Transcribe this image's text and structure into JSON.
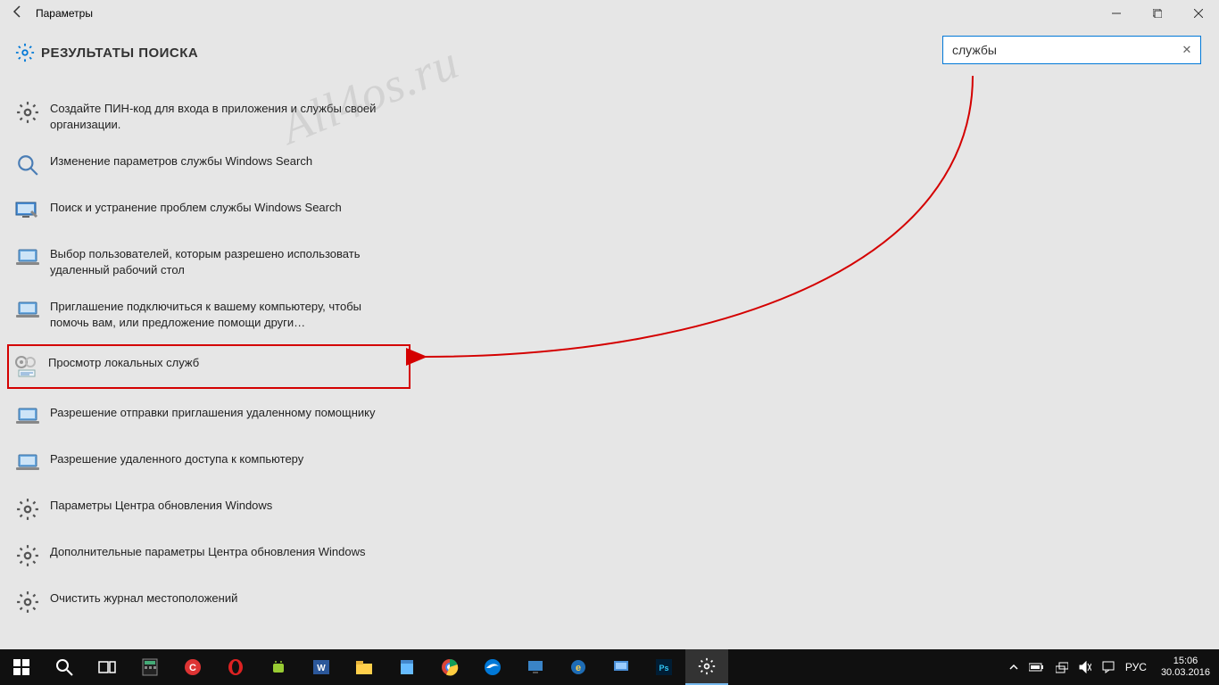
{
  "window": {
    "title": "Параметры",
    "page_heading": "РЕЗУЛЬТАТЫ ПОИСКА"
  },
  "search": {
    "value": "службы",
    "clear_symbol": "✕"
  },
  "results": [
    {
      "icon": "gear",
      "text": "Создайте ПИН-код для входа в приложения и службы своей организации."
    },
    {
      "icon": "magnifier",
      "text": "Изменение параметров службы Windows Search"
    },
    {
      "icon": "monitor-wrench",
      "text": "Поиск и устранение проблем службы Windows Search"
    },
    {
      "icon": "laptop",
      "text": "Выбор пользователей, которым разрешено использовать удаленный рабочий стол"
    },
    {
      "icon": "laptop",
      "text": "Приглашение подключиться к вашему компьютеру, чтобы помочь вам, или предложение помощи други…"
    },
    {
      "icon": "services",
      "text": "Просмотр локальных служб",
      "highlighted": true
    },
    {
      "icon": "laptop",
      "text": "Разрешение отправки приглашения удаленному помощнику"
    },
    {
      "icon": "laptop",
      "text": "Разрешение удаленного доступа к компьютеру"
    },
    {
      "icon": "gear",
      "text": "Параметры Центра обновления Windows"
    },
    {
      "icon": "gear",
      "text": "Дополнительные параметры Центра обновления Windows"
    },
    {
      "icon": "gear",
      "text": "Очистить журнал местоположений"
    }
  ],
  "watermark": "All4os.ru",
  "taskbar": {
    "tray": {
      "lang": "РУС",
      "time": "15:06",
      "date": "30.03.2016"
    }
  }
}
